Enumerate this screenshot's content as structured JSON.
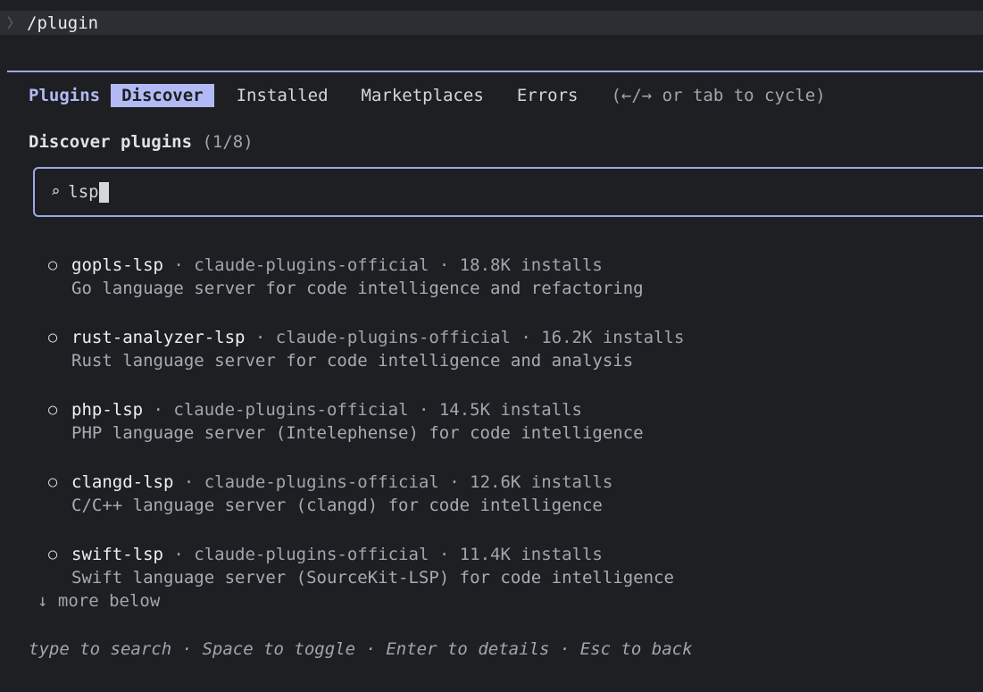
{
  "prompt": {
    "chevron": "〉",
    "command": "/plugin"
  },
  "tabs": {
    "title": "Plugins",
    "items": [
      {
        "label": "Discover",
        "active": true
      },
      {
        "label": "Installed",
        "active": false
      },
      {
        "label": "Marketplaces",
        "active": false
      },
      {
        "label": "Errors",
        "active": false
      }
    ],
    "hint": "(←/→ or tab to cycle)"
  },
  "section": {
    "title": "Discover plugins",
    "count": "(1/8)"
  },
  "search": {
    "icon": "search-icon",
    "value": "lsp"
  },
  "results": [
    {
      "name": "gopls-lsp",
      "marketplace": "claude-plugins-official",
      "installs": "18.8K installs",
      "description": "Go language server for code intelligence and refactoring"
    },
    {
      "name": "rust-analyzer-lsp",
      "marketplace": "claude-plugins-official",
      "installs": "16.2K installs",
      "description": "Rust language server for code intelligence and analysis"
    },
    {
      "name": "php-lsp",
      "marketplace": "claude-plugins-official",
      "installs": "14.5K installs",
      "description": "PHP language server (Intelephense) for code intelligence"
    },
    {
      "name": "clangd-lsp",
      "marketplace": "claude-plugins-official",
      "installs": "12.6K installs",
      "description": "C/C++ language server (clangd) for code intelligence"
    },
    {
      "name": "swift-lsp",
      "marketplace": "claude-plugins-official",
      "installs": "11.4K installs",
      "description": "Swift language server (SourceKit-LSP) for code intelligence"
    }
  ],
  "more_below": "↓ more below",
  "footer": "type to search · Space to toggle · Enter to details · Esc to back",
  "colors": {
    "background": "#1d1f23",
    "accent": "#b2baf5",
    "border": "#9fa8e6"
  }
}
